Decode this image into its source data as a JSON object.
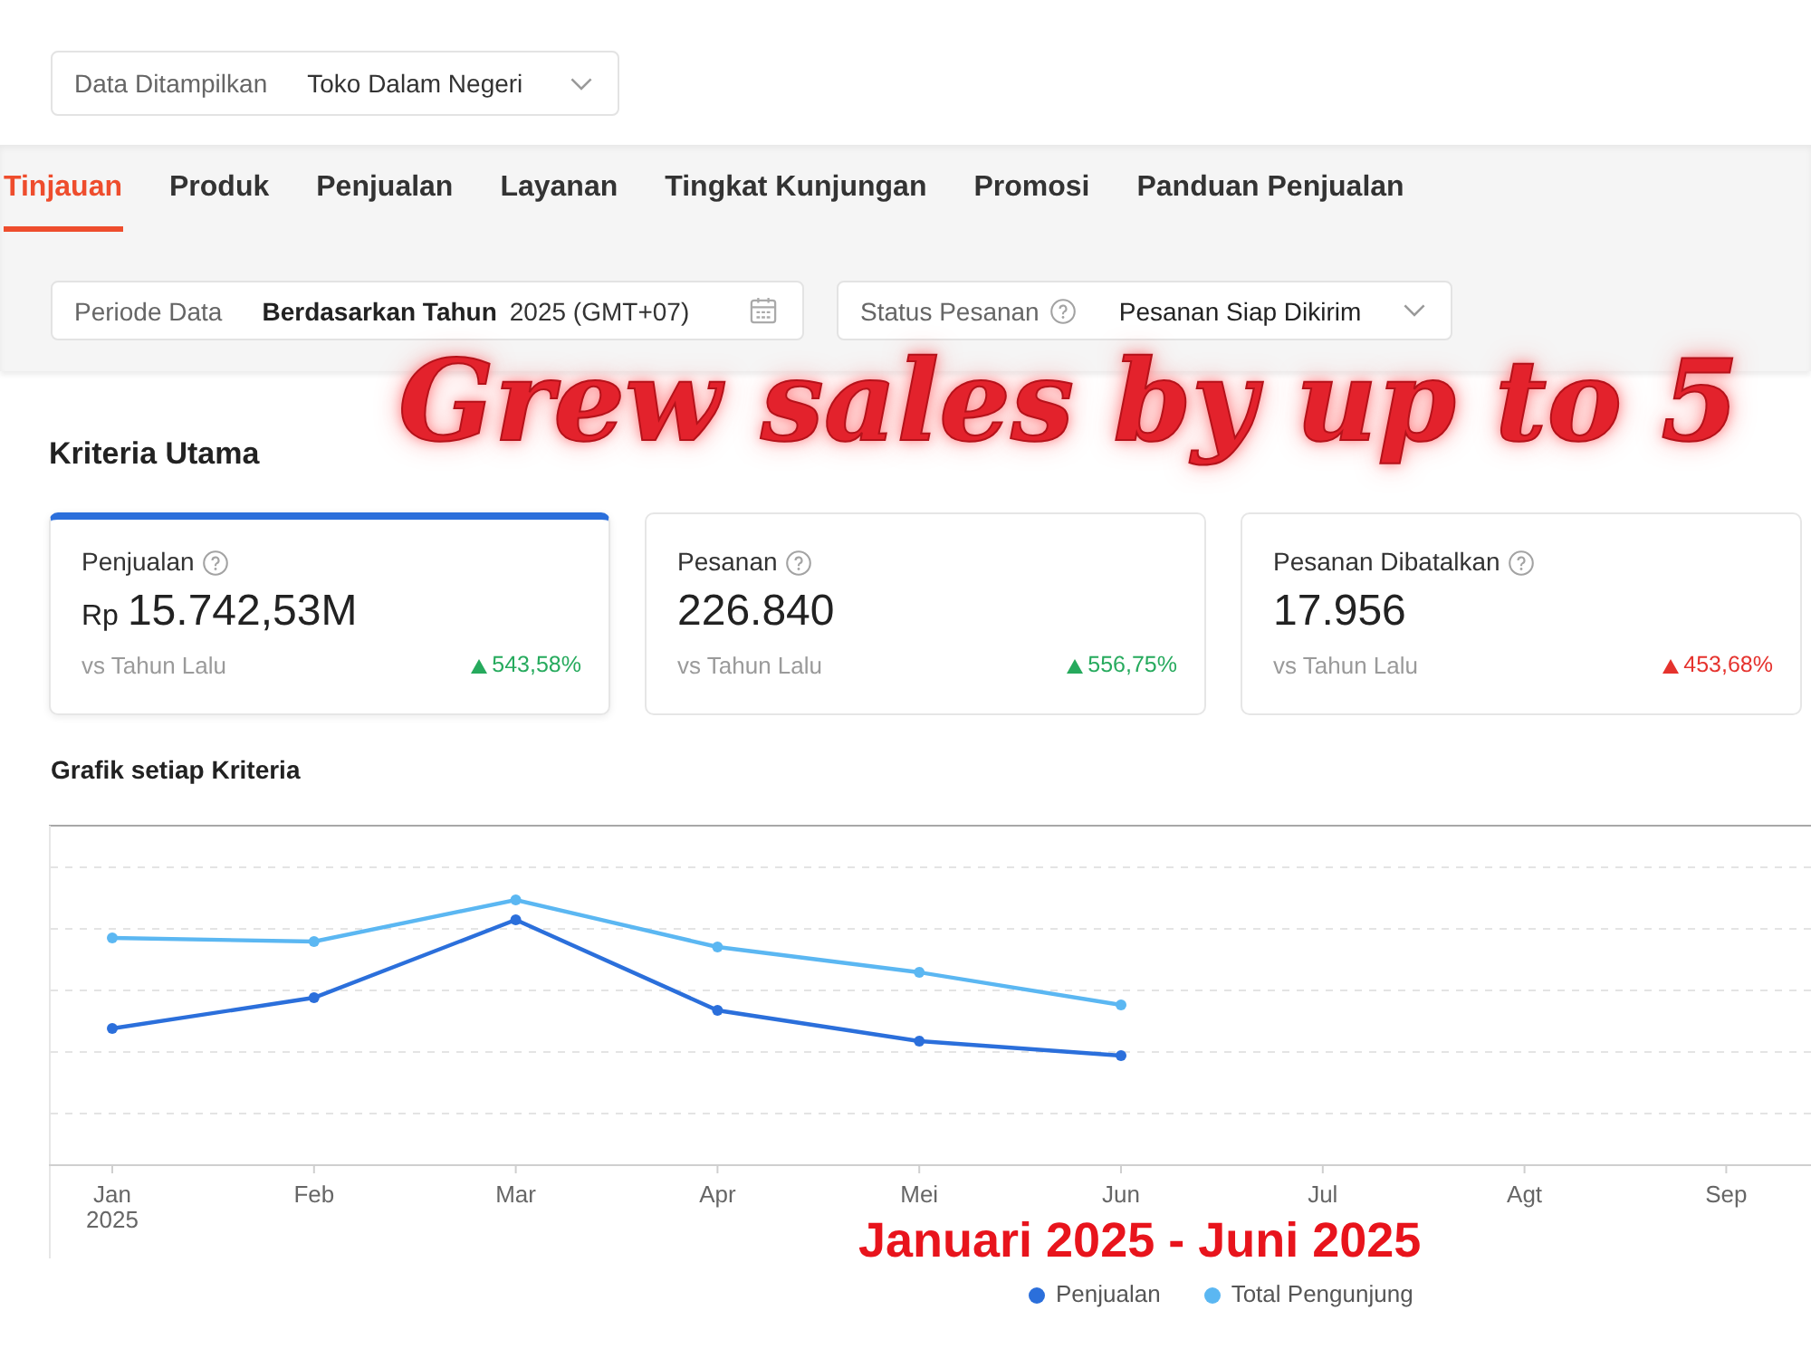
{
  "display_selector": {
    "label": "Data Ditampilkan",
    "value": "Toko Dalam Negeri"
  },
  "tabs": [
    {
      "label": "Tinjauan",
      "selected": true
    },
    {
      "label": "Produk",
      "selected": false
    },
    {
      "label": "Penjualan",
      "selected": false
    },
    {
      "label": "Layanan",
      "selected": false
    },
    {
      "label": "Tingkat Kunjungan",
      "selected": false
    },
    {
      "label": "Promosi",
      "selected": false
    },
    {
      "label": "Panduan Penjualan",
      "selected": false
    }
  ],
  "filters": [
    {
      "kind": "period",
      "label": "Periode Data",
      "value": "Berdasarkan Tahun",
      "detail": "2025 (GMT+07)"
    },
    {
      "kind": "status",
      "label": "Status Pesanan",
      "value": "Pesanan Siap Dikirim"
    }
  ],
  "headline": "Grew sales by up to 5",
  "section_title": "Kriteria Utama",
  "metrics": [
    {
      "label": "Penjualan",
      "prefix": "Rp",
      "value": "15.742,53M",
      "comparison": "vs Tahun Lalu",
      "change": "543,58%",
      "color": "#26aa5d",
      "selected": true
    },
    {
      "label": "Pesanan",
      "value": "226.840",
      "comparison": "vs Tahun Lalu",
      "change": "556,75%",
      "color": "#26aa5d",
      "selected": false
    },
    {
      "label": "Pesanan Dibatalkan",
      "value": "17.956",
      "comparison": "vs Tahun Lalu",
      "change": "453,68%",
      "color": "#e5322d",
      "selected": false
    }
  ],
  "chart": {
    "title": "Grafik setiap Kriteria",
    "x_labels": [
      {
        "label": "Jan",
        "sublabel": "2025"
      },
      {
        "label": "Feb"
      },
      {
        "label": "Mar"
      },
      {
        "label": "Apr"
      },
      {
        "label": "Mei"
      },
      {
        "label": "Jun"
      },
      {
        "label": "Jul"
      },
      {
        "label": "Agt"
      },
      {
        "label": "Sep"
      }
    ],
    "legend": [
      {
        "label": "Penjualan",
        "color": "#2b6fdb"
      },
      {
        "label": "Total Pengunjung",
        "color": "#5bb7f2"
      }
    ]
  },
  "caption": "Januari 2025 - Juni 2025"
}
